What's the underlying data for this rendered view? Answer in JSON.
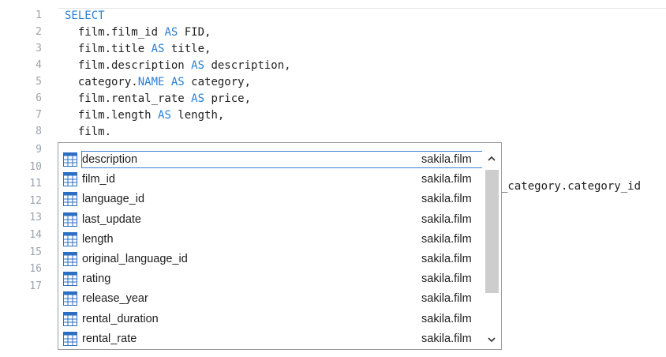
{
  "editor": {
    "lines": [
      {
        "num": "1",
        "parts": [
          {
            "t": "SELECT",
            "k": true
          }
        ]
      },
      {
        "num": "2",
        "parts": [
          {
            "t": "  film.film_id "
          },
          {
            "t": "AS",
            "k": true
          },
          {
            "t": " FID,"
          }
        ]
      },
      {
        "num": "3",
        "parts": [
          {
            "t": "  film.title "
          },
          {
            "t": "AS",
            "k": true
          },
          {
            "t": " title,"
          }
        ]
      },
      {
        "num": "4",
        "parts": [
          {
            "t": "  film.description "
          },
          {
            "t": "AS",
            "k": true
          },
          {
            "t": " description,"
          }
        ]
      },
      {
        "num": "5",
        "parts": [
          {
            "t": "  category."
          },
          {
            "t": "NAME",
            "k": true
          },
          {
            "t": " "
          },
          {
            "t": "AS",
            "k": true
          },
          {
            "t": " category,"
          }
        ]
      },
      {
        "num": "6",
        "parts": [
          {
            "t": "  film.rental_rate "
          },
          {
            "t": "AS",
            "k": true
          },
          {
            "t": " price,"
          }
        ]
      },
      {
        "num": "7",
        "parts": [
          {
            "t": "  film.length "
          },
          {
            "t": "AS",
            "k": true
          },
          {
            "t": " length,"
          }
        ]
      },
      {
        "num": "8",
        "parts": [
          {
            "t": "  film."
          }
        ]
      },
      {
        "num": "9",
        "parts": []
      },
      {
        "num": "10",
        "parts": []
      },
      {
        "num": "11",
        "parts": []
      },
      {
        "num": "12",
        "parts": []
      },
      {
        "num": "13",
        "parts": []
      },
      {
        "num": "14",
        "parts": []
      },
      {
        "num": "15",
        "parts": []
      },
      {
        "num": "16",
        "parts": []
      },
      {
        "num": "17",
        "parts": []
      }
    ],
    "partial_line_11_tail": "_category.category_id",
    "keyword_color": "#2a7fd4"
  },
  "autocomplete": {
    "items": [
      {
        "name": "description",
        "owner": "sakila.film",
        "selected": true
      },
      {
        "name": "film_id",
        "owner": "sakila.film"
      },
      {
        "name": "language_id",
        "owner": "sakila.film"
      },
      {
        "name": "last_update",
        "owner": "sakila.film"
      },
      {
        "name": "length",
        "owner": "sakila.film"
      },
      {
        "name": "original_language_id",
        "owner": "sakila.film"
      },
      {
        "name": "rating",
        "owner": "sakila.film"
      },
      {
        "name": "release_year",
        "owner": "sakila.film"
      },
      {
        "name": "rental_duration",
        "owner": "sakila.film"
      },
      {
        "name": "rental_rate",
        "owner": "sakila.film"
      }
    ],
    "item_icon": "table-column-icon",
    "selection_color": "#3c7fd1"
  }
}
